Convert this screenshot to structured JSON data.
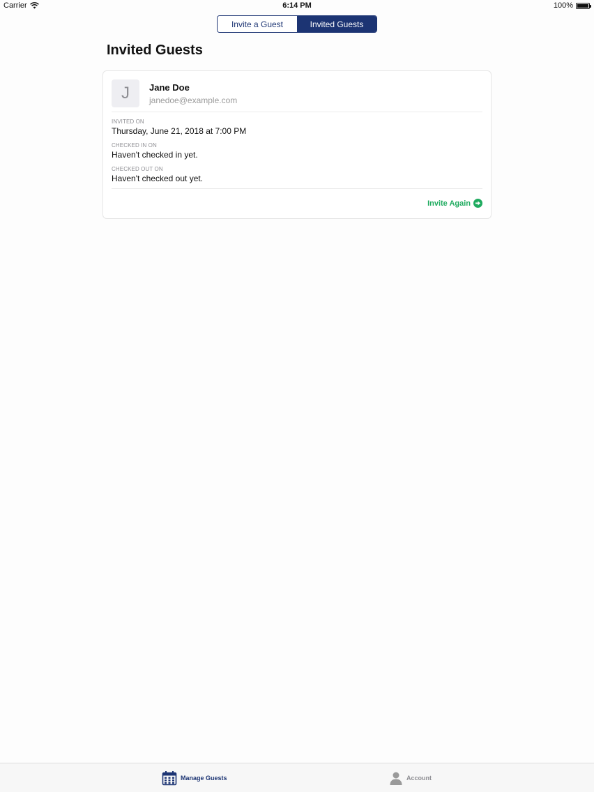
{
  "status_bar": {
    "carrier": "Carrier",
    "time": "6:14 PM",
    "battery": "100%"
  },
  "segmented": {
    "invite_label": "Invite a Guest",
    "invited_label": "Invited Guests",
    "selected": "Invited Guests"
  },
  "page": {
    "title": "Invited Guests"
  },
  "guest": {
    "initial": "J",
    "name": "Jane Doe",
    "email": "janedoe@example.com",
    "invited_on_label": "INVITED ON",
    "invited_on_value": "Thursday, June 21, 2018 at 7:00 PM",
    "checked_in_label": "CHECKED IN ON",
    "checked_in_value": "Haven't checked in yet.",
    "checked_out_label": "CHECKED OUT ON",
    "checked_out_value": "Haven't checked out yet.",
    "action_label": "Invite Again"
  },
  "tabs": [
    {
      "label": "Manage Guests",
      "icon": "calendar-icon",
      "selected": true
    },
    {
      "label": "Account",
      "icon": "person-icon",
      "selected": false
    }
  ],
  "colors": {
    "brand": "#1c3473",
    "action_green": "#1fab5f"
  }
}
